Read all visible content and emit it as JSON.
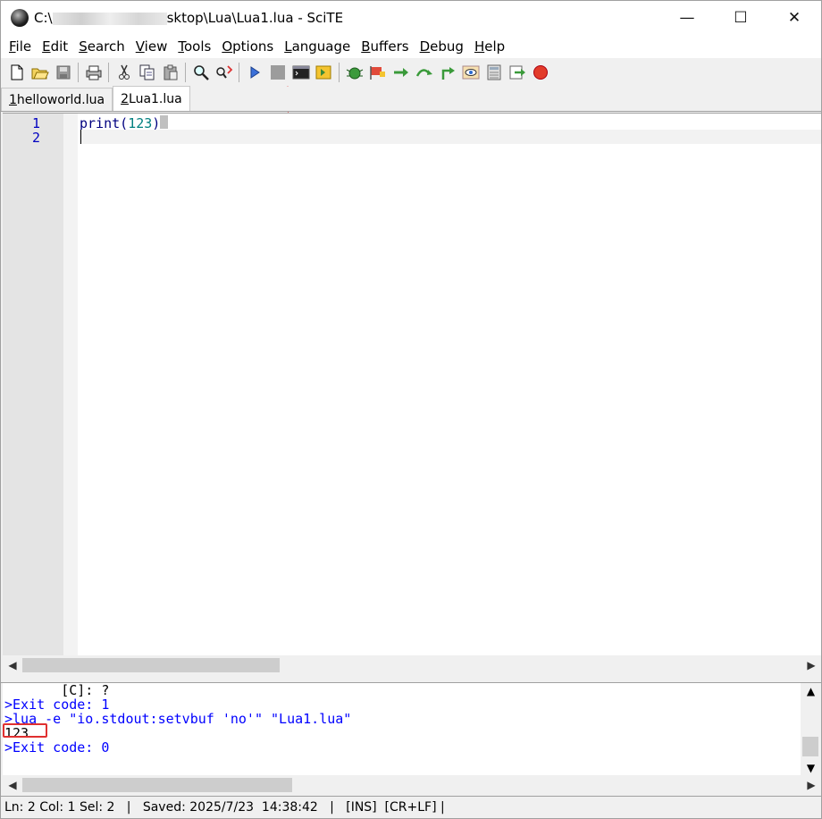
{
  "window": {
    "title_prefix": "C:\\",
    "title_suffix": "sktop\\Lua\\Lua1.lua - SciTE",
    "minimize": "—",
    "maximize": "☐",
    "close": "✕"
  },
  "menu": [
    {
      "u": "F",
      "rest": "ile"
    },
    {
      "u": "E",
      "rest": "dit"
    },
    {
      "u": "S",
      "rest": "earch"
    },
    {
      "u": "V",
      "rest": "iew"
    },
    {
      "u": "T",
      "rest": "ools"
    },
    {
      "u": "O",
      "rest": "ptions"
    },
    {
      "u": "L",
      "rest": "anguage"
    },
    {
      "u": "B",
      "rest": "uffers"
    },
    {
      "u": "D",
      "rest": "ebug"
    },
    {
      "u": "H",
      "rest": "elp"
    }
  ],
  "tabs": [
    {
      "num": "1",
      "label": " helloworld.lua"
    },
    {
      "num": "2",
      "label": " Lua1.lua"
    }
  ],
  "editor": {
    "lines": [
      {
        "num": "1",
        "fn": "print",
        "open": "(",
        "arg": "123",
        "close": ")"
      },
      {
        "num": "2"
      }
    ]
  },
  "output": {
    "lines": [
      {
        "text": "       [C]: ?",
        "color": "black"
      },
      {
        "text": ">Exit code: 1",
        "color": "blue"
      },
      {
        "text": ">lua -e \"io.stdout:setvbuf 'no'\" \"Lua1.lua\"",
        "color": "blue"
      },
      {
        "text": "123",
        "color": "black"
      },
      {
        "text": ">Exit code: 0",
        "color": "blue"
      }
    ]
  },
  "status": {
    "text": "Ln: 2 Col: 1 Sel: 2   |   Saved: 2025/7/23  14:38:42   |   [INS]  [CR+LF] |"
  },
  "icons": {
    "accent_arrow": "#e04040"
  }
}
